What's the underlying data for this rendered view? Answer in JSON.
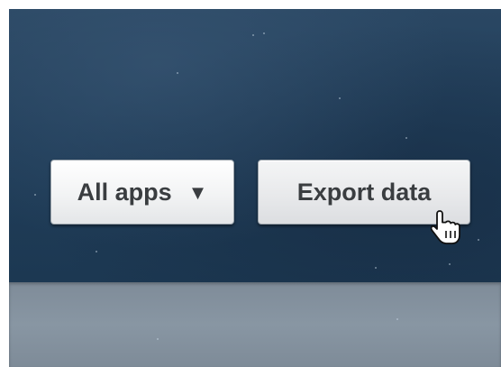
{
  "toolbar": {
    "apps_dropdown": {
      "label": "All apps",
      "caret": "▼",
      "icon": "chevron-down-icon"
    },
    "export_button": {
      "label": "Export data"
    }
  },
  "cursor": {
    "icon": "hand-pointer-icon"
  },
  "colors": {
    "background_top": "#213e5a",
    "background_bottom": "#8896a3",
    "button_face": "#f2f3f4",
    "button_text": "#3a3d40"
  }
}
